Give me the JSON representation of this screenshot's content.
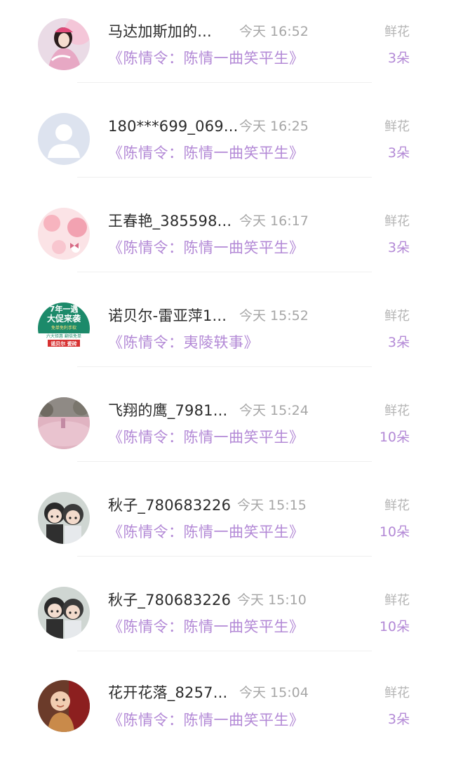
{
  "gift_list": {
    "items": [
      {
        "user": "马达加斯加的...",
        "time": "今天 16:52",
        "drama": "《陈情令：陈情一曲笑平生》",
        "gift": "鲜花",
        "count": "3朵",
        "avatar": "girl-portrait-avatar"
      },
      {
        "user": "180***699_069...",
        "time": "今天 16:25",
        "drama": "《陈情令：陈情一曲笑平生》",
        "gift": "鲜花",
        "count": "3朵",
        "avatar": "default-person-avatar"
      },
      {
        "user": "王春艳_385598...",
        "time": "今天 16:17",
        "drama": "《陈情令：陈情一曲笑平生》",
        "gift": "鲜花",
        "count": "3朵",
        "avatar": "pink-floral-avatar"
      },
      {
        "user": "诺贝尔-雷亚萍1...",
        "time": "今天 15:52",
        "drama": "《陈情令：夷陵轶事》",
        "gift": "鲜花",
        "count": "3朵",
        "avatar": "tile-ad-avatar"
      },
      {
        "user": "飞翔的鹰_7981...",
        "time": "今天 15:24",
        "drama": "《陈情令：陈情一曲笑平生》",
        "gift": "鲜花",
        "count": "10朵",
        "avatar": "pink-field-avatar"
      },
      {
        "user": "秋子_780683226",
        "time": "今天 15:15",
        "drama": "《陈情令：陈情一曲笑平生》",
        "gift": "鲜花",
        "count": "10朵",
        "avatar": "figurine-avatar"
      },
      {
        "user": "秋子_780683226",
        "time": "今天 15:10",
        "drama": "《陈情令：陈情一曲笑平生》",
        "gift": "鲜花",
        "count": "10朵",
        "avatar": "figurine-avatar"
      },
      {
        "user": "花开花落_8257...",
        "time": "今天 15:04",
        "drama": "《陈情令：陈情一曲笑平生》",
        "gift": "鲜花",
        "count": "3朵",
        "avatar": "monk-figure-avatar"
      }
    ],
    "ad_avatar_text": {
      "line1": "7年一遇",
      "line2": "大促来袭",
      "line3": "免单免利手软",
      "line4": "六大钜惠 翻倍免单",
      "line5": "诺贝尔 瓷砖"
    },
    "colors": {
      "drama_text": "#b389d6",
      "count_text": "#b389d6",
      "time_text": "#a6a6a6",
      "gift_text": "#b5b5b5",
      "name_text": "#2b2b2b"
    }
  }
}
